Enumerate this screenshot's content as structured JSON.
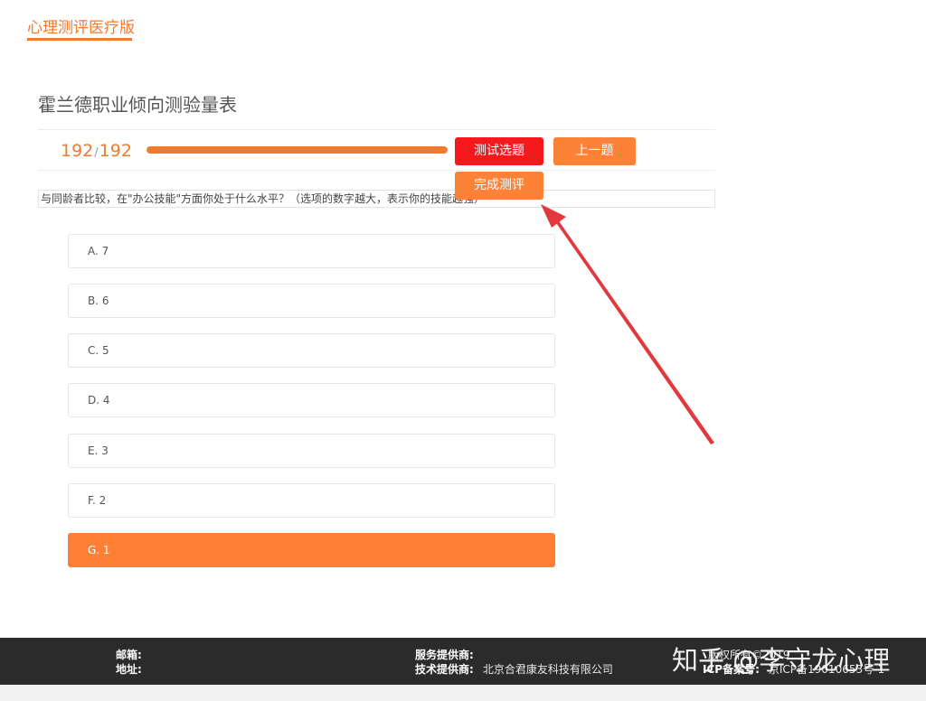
{
  "brand": {
    "title": "心理测评医疗版"
  },
  "test": {
    "title": "霍兰德职业倾向测验量表"
  },
  "progress": {
    "current": "192",
    "separator": "/",
    "total": "192",
    "fraction": 1.0
  },
  "buttons": {
    "select_questions": "测试选题",
    "previous": "上一题",
    "finish": "完成测评"
  },
  "question": {
    "text": "与同龄者比较，在\"办公技能\"方面你处于什么水平？（选项的数字越大，表示你的技能越强）"
  },
  "options": [
    {
      "label": "A. 7",
      "selected": false
    },
    {
      "label": "B. 6",
      "selected": false
    },
    {
      "label": "C. 5",
      "selected": false
    },
    {
      "label": "D. 4",
      "selected": false
    },
    {
      "label": "E. 3",
      "selected": false
    },
    {
      "label": "F. 2",
      "selected": false
    },
    {
      "label": "G. 1",
      "selected": true
    }
  ],
  "footer": {
    "email_label": "邮箱:",
    "address_label": "地址:",
    "service_provider_label": "服务提供商:",
    "tech_provider_label": "技术提供商:",
    "tech_provider_value": "北京合君康友科技有限公司",
    "copyright": "版权所有©2019",
    "icp_label": "ICP备案号:",
    "icp_value": "京ICP备19010653号-1"
  },
  "watermark": "知乎 @李守龙心理",
  "colors": {
    "accent": "#f07a2d",
    "danger": "#f5191d",
    "button_orange": "#fc8237",
    "arrow": "#e03a3e",
    "footer_bg": "#2b2b2b"
  }
}
